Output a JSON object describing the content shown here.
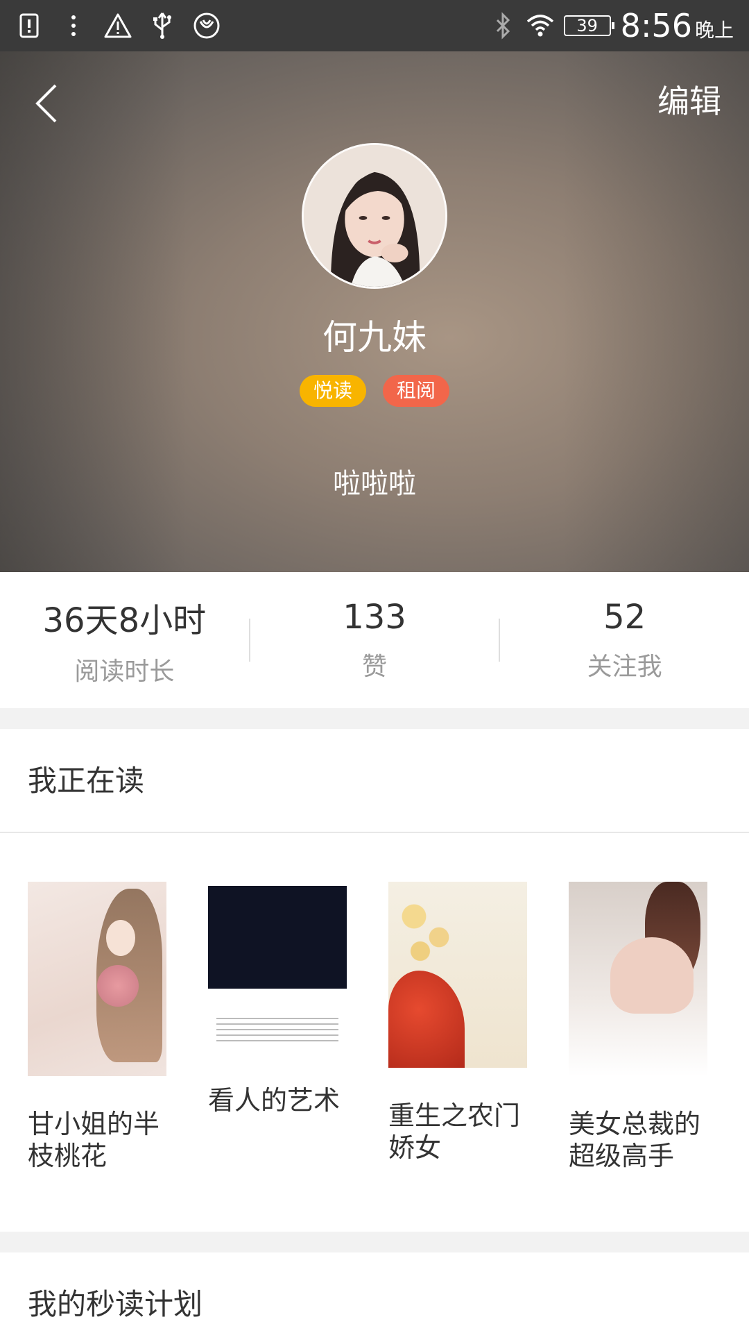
{
  "status_bar": {
    "battery": "39",
    "time": "8:56",
    "time_suffix": "晚上",
    "icons": [
      "sim-alert-icon",
      "more-dots-icon",
      "warning-icon",
      "usb-icon",
      "app-icon",
      "bluetooth-icon",
      "wifi-icon",
      "battery-icon"
    ]
  },
  "header": {
    "back_icon": "chevron-left-icon",
    "edit_label": "编辑",
    "username": "何九妹",
    "badges": [
      {
        "label": "悦读",
        "color": "#f8b400"
      },
      {
        "label": "租阅",
        "color": "#f2664a"
      }
    ],
    "bio": "啦啦啦"
  },
  "stats": [
    {
      "value": "36天8小时",
      "label": "阅读时长"
    },
    {
      "value": "133",
      "label": "赞"
    },
    {
      "value": "52",
      "label": "关注我"
    }
  ],
  "reading": {
    "title": "我正在读",
    "books": [
      {
        "title": "甘小姐的半枝桃花"
      },
      {
        "title": "看人的艺术"
      },
      {
        "title": "重生之农门娇女"
      },
      {
        "title": "美女总裁的超级高手"
      }
    ]
  },
  "plan": {
    "title": "我的秒读计划"
  }
}
